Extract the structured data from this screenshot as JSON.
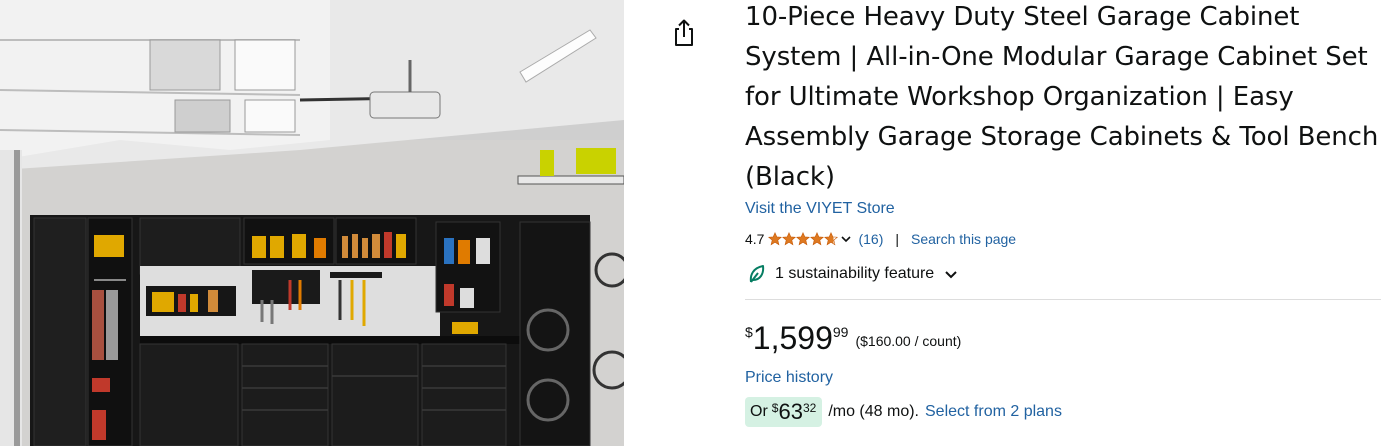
{
  "product": {
    "title": "10-Piece Heavy Duty Steel Garage Cabinet System | All-in-One Modular Garage Cabinet Set for Ultimate Workshop Organization | Easy Assembly Garage Storage Cabinets & Tool Bench (Black)",
    "store_link": "Visit the VIYET Store",
    "image_icon": "product-photo-garage-cabinets"
  },
  "share": {
    "icon": "share-icon"
  },
  "rating": {
    "value": "4.7",
    "stars": 4.7,
    "review_count": "(16)",
    "separator": "|",
    "search_link": "Search this page",
    "star_color": "#de7921"
  },
  "sustainability": {
    "label": "1 sustainability feature",
    "icon": "leaf-icon",
    "icon_color": "#067d62"
  },
  "price": {
    "symbol": "$",
    "whole": "1,599",
    "fraction": "99",
    "unit_price": "($160.00 / count)",
    "history_link": "Price history"
  },
  "monthly": {
    "prefix": "Or",
    "symbol": "$",
    "whole": "63",
    "fraction": "32",
    "term": "/mo (48 mo).",
    "plans_link": "Select from 2 plans",
    "badge_color": "#d5f1e3"
  },
  "colors": {
    "link": "#2162a1",
    "text": "#0f1111"
  }
}
